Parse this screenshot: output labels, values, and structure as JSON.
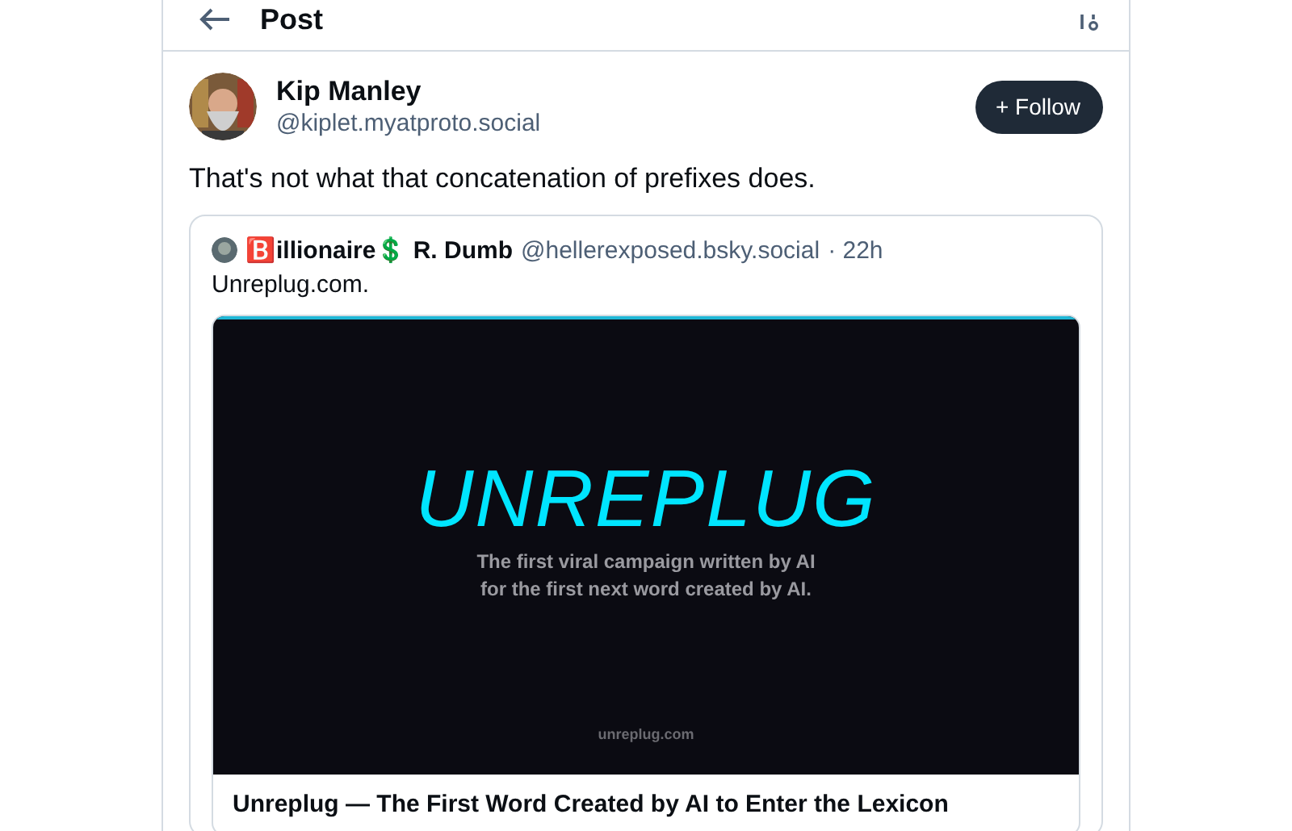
{
  "header": {
    "title": "Post"
  },
  "post": {
    "author": {
      "name": "Kip Manley",
      "handle": "@kiplet.myatproto.social"
    },
    "follow_button": {
      "icon": "+",
      "label": "Follow"
    },
    "text": "That's not what that concatenation of prefixes does.",
    "quote": {
      "author": {
        "name": "🅱️illionaire💲 R. Dumb",
        "handle": "@hellerexposed.bsky.social",
        "time": "· 22h"
      },
      "text": "Unreplug.com.",
      "link_card": {
        "image": {
          "headline": "UNREPLUG",
          "tagline": "The first viral campaign written by AI\nfor the first next word created by AI.",
          "site": "unreplug.com"
        },
        "title": "Unreplug — The First Word Created by AI to Enter the Lexicon"
      }
    }
  }
}
